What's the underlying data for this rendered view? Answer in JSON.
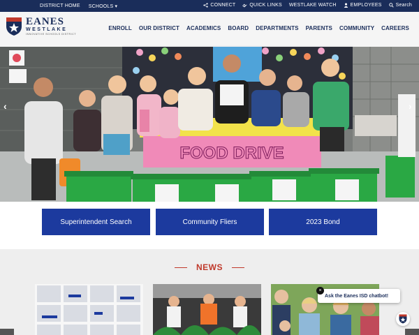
{
  "topbar": {
    "left": [
      "DISTRICT HOME",
      "SCHOOLS ▾"
    ],
    "connect": "CONNECT",
    "quick_links": "QUICK LINKS",
    "westlake_watch": "WESTLAKE WATCH",
    "employees": "EMPLOYEES",
    "search": "Search"
  },
  "logo": {
    "name": "EANES",
    "sub": "WESTLAKE",
    "tag": "INNOVATIVE SCHOOLS DISTRICT",
    "shield_text": "AUSTIN TX"
  },
  "nav": [
    "ENROLL",
    "OUR DISTRICT",
    "ACADEMICS",
    "BOARD",
    "DEPARTMENTS",
    "PARENTS",
    "COMMUNITY",
    "CAREERS"
  ],
  "hero": {
    "banner_text": "FOOD DRIVE",
    "prev": "‹",
    "next": "›"
  },
  "buttons": [
    "Superintendent Search",
    "Community Fliers",
    "2023 Bond"
  ],
  "news": {
    "title": "NEWS"
  },
  "chatbot": {
    "label": "Ask the Eanes ISD chatbot!",
    "close": "×"
  },
  "colors": {
    "topbar": "#1a2d5a",
    "button": "#1c3a9e",
    "news_accent": "#c0392b"
  }
}
